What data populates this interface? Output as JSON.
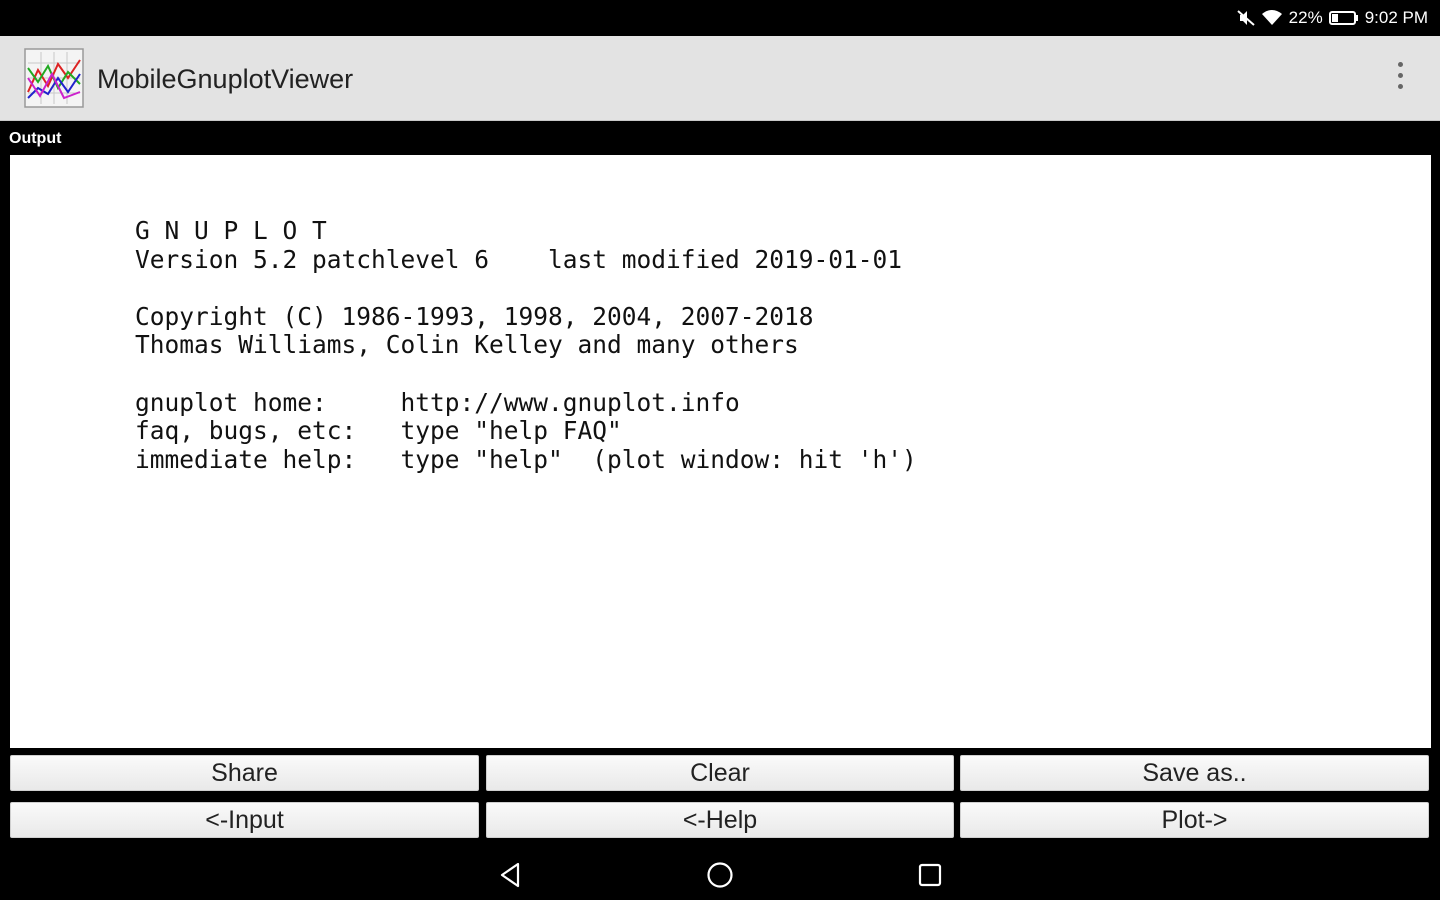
{
  "status_bar": {
    "battery": "22%",
    "time": "9:02 PM"
  },
  "app_bar": {
    "title": "MobileGnuplotViewer",
    "icon": "app-logo-icon",
    "menu_icon": "overflow-menu-icon"
  },
  "output": {
    "label": "Output",
    "lines": [
      "G N U P L O T",
      "Version 5.2 patchlevel 6    last modified 2019-01-01",
      "",
      "Copyright (C) 1986-1993, 1998, 2004, 2007-2018",
      "Thomas Williams, Colin Kelley and many others",
      "",
      "gnuplot home:     http://www.gnuplot.info",
      "faq, bugs, etc:   type \"help FAQ\"",
      "immediate help:   type \"help\"  (plot window: hit 'h')"
    ]
  },
  "buttons": {
    "share": "Share",
    "clear": "Clear",
    "save_as": "Save as..",
    "input": "<-Input",
    "help": "<-Help",
    "plot": "Plot->"
  },
  "nav": {
    "back": "back-icon",
    "home": "home-icon",
    "recents": "recents-icon"
  }
}
